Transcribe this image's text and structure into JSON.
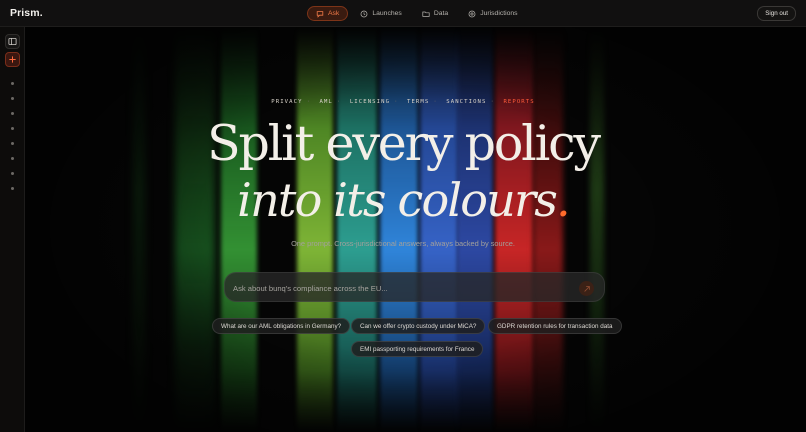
{
  "app": {
    "brand": "Prism",
    "brand_dot": "."
  },
  "nav": {
    "items": [
      {
        "label": "Ask",
        "icon": "chat-icon",
        "active": true
      },
      {
        "label": "Launches",
        "icon": "clock-icon",
        "active": false
      },
      {
        "label": "Data",
        "icon": "folder-icon",
        "active": false
      },
      {
        "label": "Jurisdictions",
        "icon": "globe-icon",
        "active": false
      }
    ],
    "signout_label": "Sign out"
  },
  "sidebar": {
    "toggle_icon": "panel-icon",
    "add_icon": "plus-icon",
    "dot_count": 8
  },
  "hero": {
    "tags": [
      "PRIVACY",
      "AML",
      "LICENSING",
      "TERMS",
      "SANCTIONS",
      "REPORTS"
    ],
    "line1": "Split every policy",
    "line2": "into its colours",
    "line2_accent": ".",
    "subtitle": "One prompt. Cross-jurisdictional answers, always backed by source."
  },
  "search": {
    "placeholder": "Ask about bunq's compliance across the EU...",
    "value": "",
    "send_icon": "arrow-icon"
  },
  "suggestions": [
    "What are our AML obligations in Germany?",
    "Can we offer crypto custody under MiCA?",
    "GDPR retention rules for transaction data",
    "EMI passporting requirements for France"
  ],
  "colors": {
    "accent": "#ff6a2b",
    "bands": [
      "#2aa33a",
      "#5fb83a",
      "#22a89c",
      "#2a6fd0",
      "#3a56c9",
      "#1f3f8f",
      "#d42a26"
    ]
  }
}
